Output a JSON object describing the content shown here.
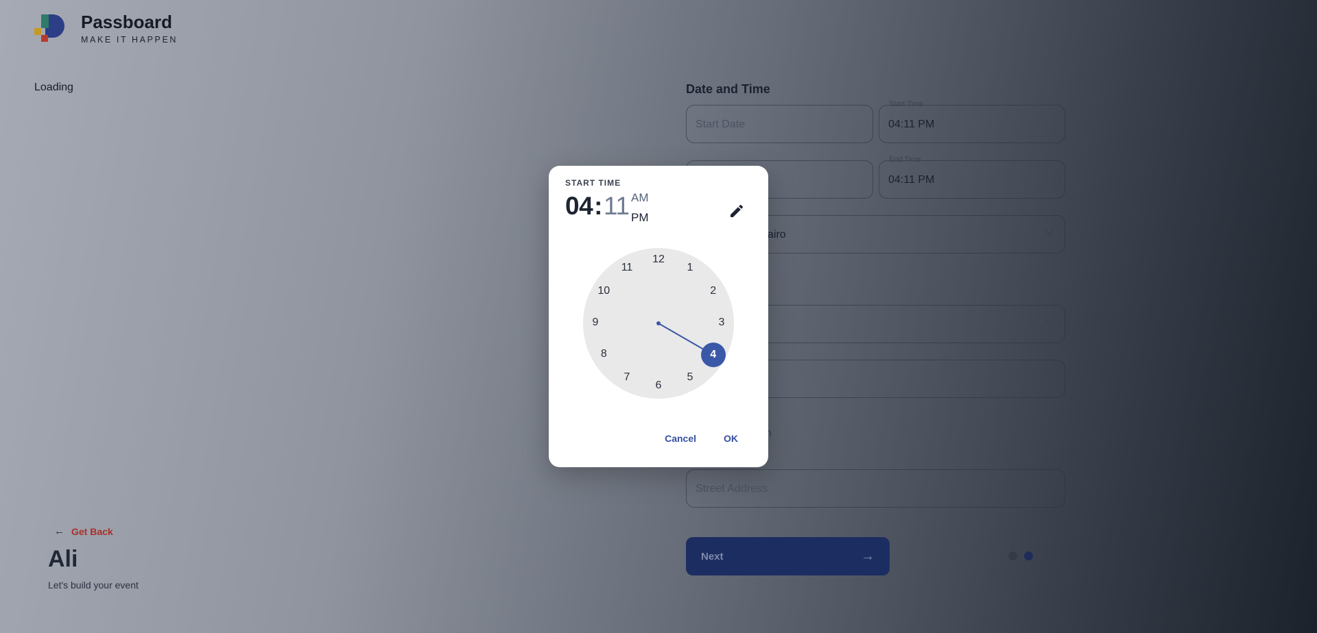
{
  "brand": {
    "name": "Passboard",
    "tagline": "MAKE IT HAPPEN"
  },
  "status": {
    "loading": "Loading"
  },
  "left": {
    "back_label": "Get Back",
    "back_icon": "arrow-left-icon",
    "user_name": "Ali",
    "subtitle": "Let's build your event"
  },
  "form": {
    "section_title": "Date and Time",
    "start_date": {
      "placeholder": "Start Date"
    },
    "start_time": {
      "label": "Start Time",
      "value": "04:11 PM"
    },
    "end_time": {
      "label": "End Time",
      "value": "04:11 PM"
    },
    "timezone": {
      "partial_value": "airo"
    },
    "partial_text": "n",
    "street": {
      "placeholder": "Street Address"
    },
    "next_label": "Next",
    "steps_total": 2,
    "steps_active": 2
  },
  "time_picker": {
    "title": "START TIME",
    "hour": "04",
    "separator": ":",
    "minute": "11",
    "am": "AM",
    "pm": "PM",
    "selected_period": "PM",
    "selected_hour": "4",
    "clock_numbers": [
      "12",
      "1",
      "2",
      "3",
      "4",
      "5",
      "6",
      "7",
      "8",
      "9",
      "10",
      "11"
    ],
    "edit_icon": "pencil-icon",
    "cancel": "Cancel",
    "ok": "OK"
  },
  "colors": {
    "accent": "#3b57a8",
    "danger": "#a8302b",
    "primary_dark": "#1c2d62"
  }
}
